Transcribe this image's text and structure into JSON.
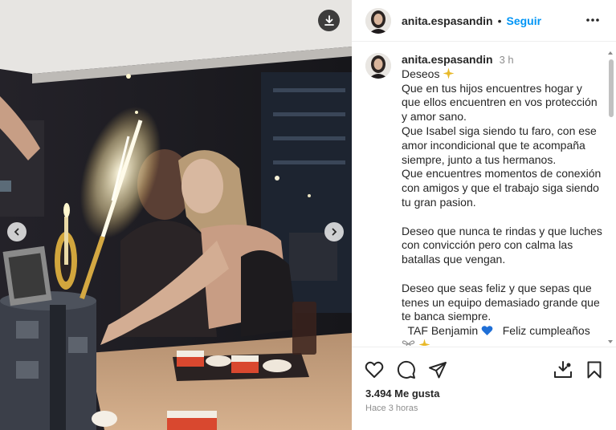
{
  "post": {
    "username": "anita.espasandin",
    "follow_label": "Seguir",
    "dot": "•",
    "time": "3 h",
    "caption_lines": [
      "Deseos",
      "Que en tus hijos encuentres hogar y",
      "que ellos encuentren en vos protección",
      "y amor sano.",
      "Que Isabel siga siendo tu faro, con ese",
      "amor incondicional que te acompaña",
      "siempre, junto a tus hermanos.",
      "Que encuentres momentos de conexión",
      "con amigos y que el trabajo siga siendo",
      "tu gran pasion.",
      "",
      "Deseo que nunca te rindas y que luches",
      "con convicción pero con calma las",
      "batallas que vengan.",
      "",
      "Deseo que seas feliz y que sepas que",
      "tenes un equipo demasiado grande que",
      "te banca siempre.",
      "  TAF Benjamin",
      "Feliz cumpleaños"
    ],
    "likes": "3.494 Me gusta",
    "posted_ago": "Hace 3 horas"
  },
  "icons": {
    "more": "more-options-icon",
    "download": "download-icon",
    "prev": "chevron-left-icon",
    "next": "chevron-right-icon",
    "like": "heart-icon",
    "comment": "comment-icon",
    "share": "send-icon",
    "save": "bookmark-icon",
    "repost": "repost-icon"
  },
  "colors": {
    "link_blue": "#0095f6",
    "heart_blue": "#1f6fd6",
    "sparkle_gold": "#e8b92a"
  }
}
